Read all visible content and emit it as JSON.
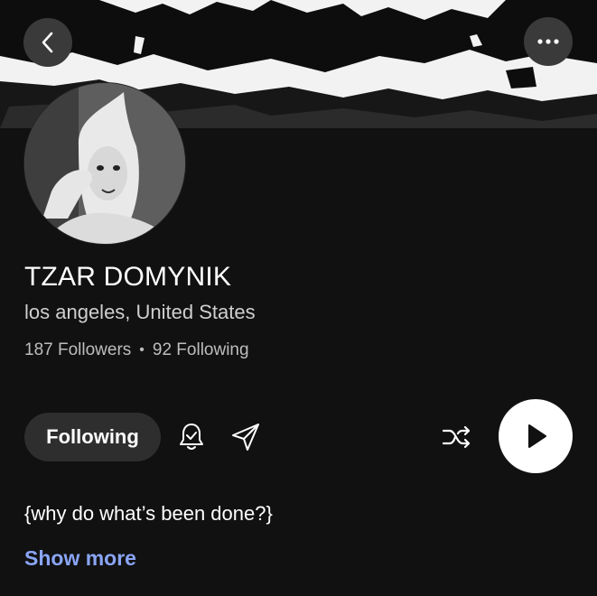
{
  "header": {
    "back_icon": "chevron-left-icon",
    "more_icon": "ellipsis-icon"
  },
  "profile": {
    "name": "TZAR DOMYNIK",
    "location": "los angeles, United States",
    "followers": "187 Followers",
    "separator": "•",
    "following": "92 Following",
    "bio": "{why do what’s been done?}",
    "show_more": "Show more"
  },
  "actions": {
    "following_label": "Following",
    "bell_icon": "bell-check-icon",
    "share_icon": "send-icon",
    "shuffle_icon": "shuffle-icon",
    "play_icon": "play-icon"
  },
  "colors": {
    "background": "#111112",
    "link": "#8aa5f5",
    "button_bg": "#2e2e2e"
  }
}
